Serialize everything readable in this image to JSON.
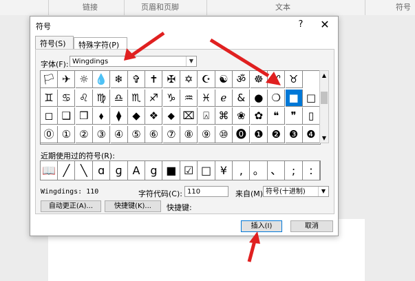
{
  "ribbon": {
    "labels": [
      "链接",
      "页眉和页脚",
      "文本",
      "符号"
    ]
  },
  "dialog": {
    "title": "符号",
    "help": "?",
    "close": "✕",
    "tabs": [
      {
        "label": "符号(S)",
        "active": true
      },
      {
        "label": "特殊字符(P)",
        "active": false
      }
    ],
    "font_label": "字体(F):",
    "font_value": "Wingdings",
    "symbols": [
      [
        "🏳",
        "✈",
        "☼",
        "💧",
        "❄",
        "✞",
        "✝",
        "✠",
        "✡",
        "☪",
        "☯",
        "ॐ",
        "☸",
        "♈",
        "♉"
      ],
      [
        "♊",
        "♋",
        "♌",
        "♍",
        "♎",
        "♏",
        "♐",
        "♑",
        "♒",
        "♓",
        "ℯ",
        "&",
        "●",
        "❍",
        "■",
        "□"
      ],
      [
        "◻",
        "❑",
        "❒",
        "⬧",
        "⧫",
        "◆",
        "❖",
        "⬥",
        "⌧",
        "⍓",
        "⌘",
        "❀",
        "✿",
        "❝",
        "❞",
        "▯"
      ],
      [
        "⓪",
        "①",
        "②",
        "③",
        "④",
        "⑤",
        "⑥",
        "⑦",
        "⑧",
        "⑨",
        "⑩",
        "⓿",
        "❶",
        "❷",
        "❸",
        "❹"
      ]
    ],
    "selected_symbol": "■",
    "recent_label": "近期使用过的符号(R):",
    "recent": [
      "📖",
      "╱",
      "╲",
      "ɑ",
      "ɡ",
      "A",
      "g",
      "■",
      "☑",
      "□",
      "¥",
      ",",
      "。",
      "、",
      ";",
      ":"
    ],
    "description": "Wingdings: 110",
    "code_label": "字符代码(C):",
    "code_value": "110",
    "from_label": "来自(M):",
    "from_value": "符号(十进制)",
    "autocorrect_button": "自动更正(A)...",
    "shortcut_button": "快捷键(K)...",
    "shortcut_label": "快捷键:",
    "insert_button": "插入(I)",
    "cancel_button": "取消"
  },
  "colors": {
    "selection": "#0078d7",
    "annotation": "#e02020"
  }
}
